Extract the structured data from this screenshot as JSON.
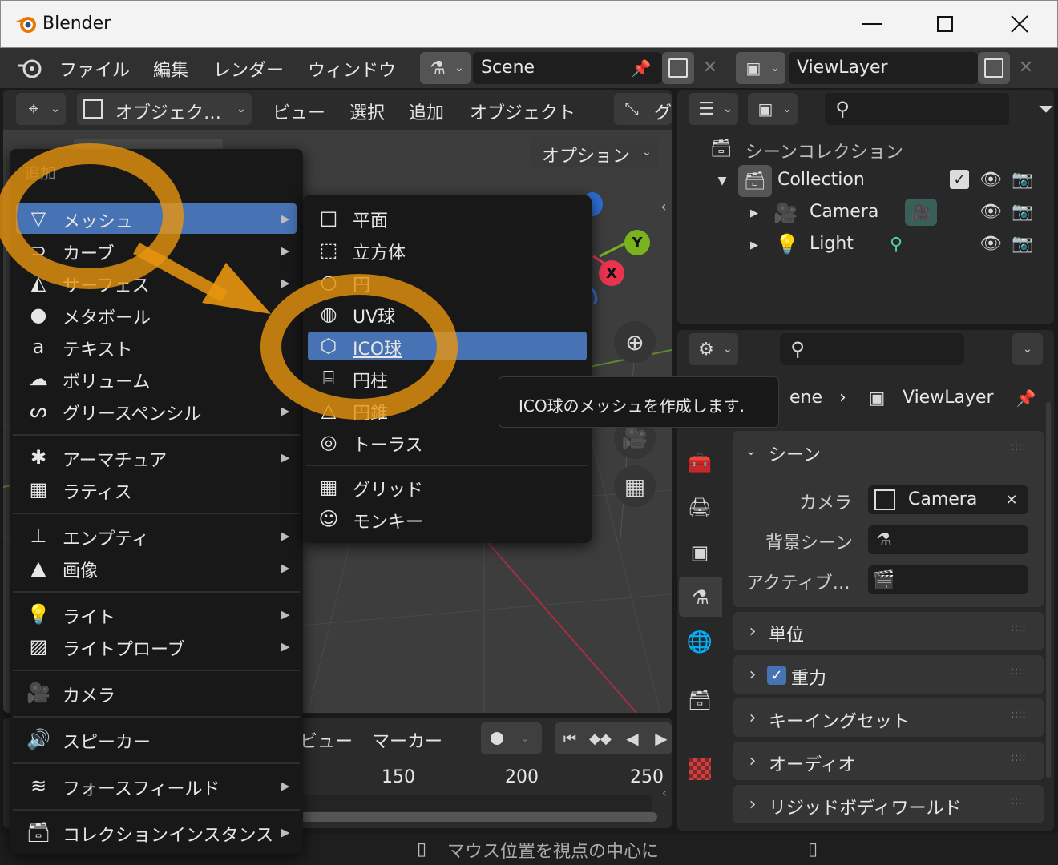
{
  "window": {
    "title": "Blender"
  },
  "topbar": {
    "menus": [
      "ファイル",
      "編集",
      "レンダー",
      "ウィンドウ"
    ],
    "scene_name": "Scene",
    "view_layer_name": "ViewLayer"
  },
  "viewport_header": {
    "mode_label": "オブジェク…",
    "menus": [
      "ビュー",
      "選択",
      "追加",
      "オブジェクト"
    ],
    "truncated_label": "グ",
    "options_label": "オプション"
  },
  "gizmo": {
    "y_label": "Y",
    "x_label": "X"
  },
  "add_menu": {
    "title": "追加",
    "items": [
      {
        "label": "メッシュ",
        "icon": "mesh-icon"
      },
      {
        "label": "カーブ",
        "icon": "curve-icon"
      },
      {
        "label": "サーフェス",
        "icon": "surface-icon"
      },
      {
        "label": "メタボール",
        "icon": "metaball-icon"
      },
      {
        "label": "テキスト",
        "icon": "text-icon"
      },
      {
        "label": "ボリューム",
        "icon": "volume-icon"
      },
      {
        "label": "グリースペンシル",
        "icon": "grease-pencil-icon"
      },
      {
        "label": "アーマチュア",
        "icon": "armature-icon"
      },
      {
        "label": "ラティス",
        "icon": "lattice-icon"
      },
      {
        "label": "エンプティ",
        "icon": "empty-icon"
      },
      {
        "label": "画像",
        "icon": "image-icon"
      },
      {
        "label": "ライト",
        "icon": "light-icon"
      },
      {
        "label": "ライトプローブ",
        "icon": "light-probe-icon"
      },
      {
        "label": "カメラ",
        "icon": "camera-icon"
      },
      {
        "label": "スピーカー",
        "icon": "speaker-icon"
      },
      {
        "label": "フォースフィールド",
        "icon": "force-field-icon"
      },
      {
        "label": "コレクションインスタンス",
        "icon": "collection-instance-icon"
      }
    ]
  },
  "mesh_submenu": {
    "items": [
      {
        "label": "平面",
        "icon": "plane-icon"
      },
      {
        "label": "立方体",
        "icon": "cube-icon"
      },
      {
        "label": "円",
        "icon": "circle-icon"
      },
      {
        "label": "UV球",
        "icon": "uv-sphere-icon"
      },
      {
        "label": "ICO球",
        "icon": "ico-sphere-icon"
      },
      {
        "label": "円柱",
        "icon": "cylinder-icon"
      },
      {
        "label": "円錐",
        "icon": "cone-icon"
      },
      {
        "label": "トーラス",
        "icon": "torus-icon"
      },
      {
        "label": "グリッド",
        "icon": "grid-icon"
      },
      {
        "label": "モンキー",
        "icon": "monkey-icon"
      }
    ],
    "selected": "ICO球"
  },
  "tooltip": {
    "text": "ICO球のメッシュを作成します."
  },
  "outliner": {
    "scene_collection": "シーンコレクション",
    "collection": "Collection",
    "items": [
      {
        "label": "Camera",
        "icon": "camera-object-icon"
      },
      {
        "label": "Light",
        "icon": "light-object-icon"
      }
    ]
  },
  "properties": {
    "breadcrumb_scene": "ene",
    "breadcrumb_layer": "ViewLayer",
    "scene_panel": "シーン",
    "camera_label": "カメラ",
    "camera_value": "Camera",
    "background_label": "背景シーン",
    "active_label": "アクティブ…",
    "panels": [
      "単位",
      "重力",
      "キーイングセット",
      "オーディオ",
      "リジッドボディワールド"
    ]
  },
  "timeline": {
    "menus": [
      "ビュー",
      "マーカー"
    ],
    "frames": [
      "150",
      "200",
      "250"
    ]
  },
  "statusbar": {
    "hint": "マウス位置を視点の中心に"
  },
  "colors": {
    "accent": "#4772b3",
    "annotation": "#e8950f",
    "axis_x": "#e8344f",
    "axis_y": "#7bb31f"
  }
}
